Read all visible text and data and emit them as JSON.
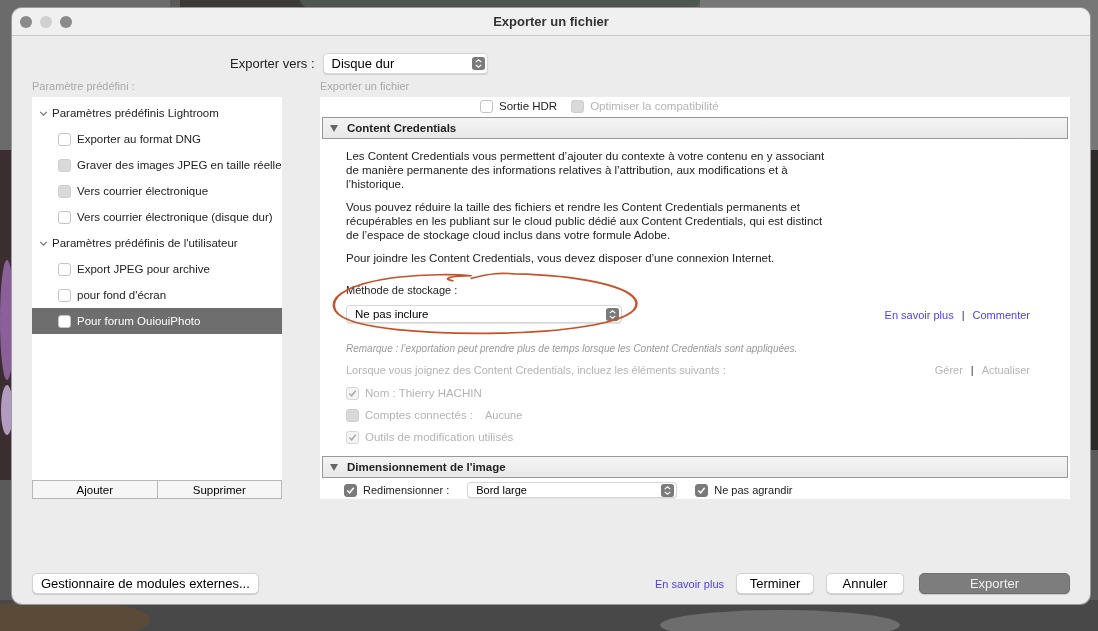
{
  "window": {
    "title": "Exporter un fichier"
  },
  "export_to": {
    "label": "Exporter vers :",
    "value": "Disque dur"
  },
  "presets": {
    "label": "Paramètre prédéfini :",
    "groups": [
      {
        "name": "Paramètres prédéfinis Lightroom",
        "expanded": true,
        "children": [
          {
            "label": "Exporter au format DNG",
            "checked": false,
            "disabled": false,
            "selected": false
          },
          {
            "label": "Graver des images JPEG en taille réelle",
            "checked": false,
            "disabled": true,
            "selected": false
          },
          {
            "label": "Vers courrier électronique",
            "checked": false,
            "disabled": true,
            "selected": false
          },
          {
            "label": "Vers courrier électronique (disque dur)",
            "checked": false,
            "disabled": false,
            "selected": false
          }
        ]
      },
      {
        "name": "Paramètres prédéfinis de l'utilisateur",
        "expanded": true,
        "children": [
          {
            "label": "Export JPEG pour archive",
            "checked": false,
            "disabled": false,
            "selected": false
          },
          {
            "label": "pour fond d'écran",
            "checked": false,
            "disabled": false,
            "selected": false
          },
          {
            "label": "Pour forum OuiouiPhoto",
            "checked": false,
            "disabled": false,
            "selected": true
          }
        ]
      }
    ],
    "buttons": [
      "Ajouter",
      "Supprimer"
    ]
  },
  "settings": {
    "label": "Exporter un fichier",
    "top_options": [
      {
        "label": "Sortie HDR",
        "checked": false,
        "disabled": false
      },
      {
        "label": "Optimiser la compatibilité",
        "checked": false,
        "disabled": true
      }
    ],
    "content_credentials": {
      "title": "Content Credentials",
      "expanded": true,
      "paragraphs": [
        "Les Content Credentials vous permettent d’ajouter du contexte à votre contenu en y associant de manière permanente des informations relatives à l’attribution, aux modifications et à l’historique.",
        "Vous pouvez réduire la taille des fichiers et rendre les Content Credentials permanents et récupérables en les publiant sur le cloud public dédié aux Content Credentials, qui est distinct de l’espace de stockage cloud inclus dans votre formule Adobe.",
        "Pour joindre les Content Credentials, vous devez disposer d’une connexion Internet."
      ],
      "storage": {
        "label": "Méthode de stockage :",
        "value": "Ne pas inclure"
      },
      "links": [
        {
          "kind": "link",
          "text": "En savoir plus",
          "disabled": false
        },
        {
          "kind": "separator",
          "text": "|"
        },
        {
          "kind": "link",
          "text": "Commenter",
          "disabled": false
        }
      ],
      "note": "Remarque : l’exportation peut prendre plus de temps lorsque les Content Credentials sont appliquées.",
      "include_label": "Lorsque vous joignez des Content Credentials, incluez les éléments suivants :",
      "include_links": [
        {
          "kind": "link",
          "text": "Gérer",
          "disabled": true
        },
        {
          "kind": "separator",
          "text": "|"
        },
        {
          "kind": "link",
          "text": "Actualiser",
          "disabled": true
        }
      ],
      "include_items": [
        {
          "label": "Nom : Thierry HACHIN",
          "checked": true,
          "disabled": true
        },
        {
          "label": "Comptes connectés :",
          "value": "Aucune",
          "checked": false,
          "disabled": true
        },
        {
          "label": "Outils de modification utilisés",
          "checked": true,
          "disabled": true
        }
      ]
    },
    "image_sizing": {
      "title": "Dimensionnement de l'image",
      "expanded": true,
      "resize": {
        "label": "Redimensionner :",
        "checked": true,
        "value": "Bord large"
      },
      "dont_enlarge": {
        "label": "Ne pas agrandir",
        "checked": true
      }
    }
  },
  "footer": {
    "plugin_button": "Gestionnaire de modules externes...",
    "learn_more": "En savoir plus",
    "buttons": [
      {
        "label": "Terminer",
        "kind": "normal"
      },
      {
        "label": "Annuler",
        "kind": "normal"
      },
      {
        "label": "Exporter",
        "kind": "primary"
      }
    ]
  }
}
